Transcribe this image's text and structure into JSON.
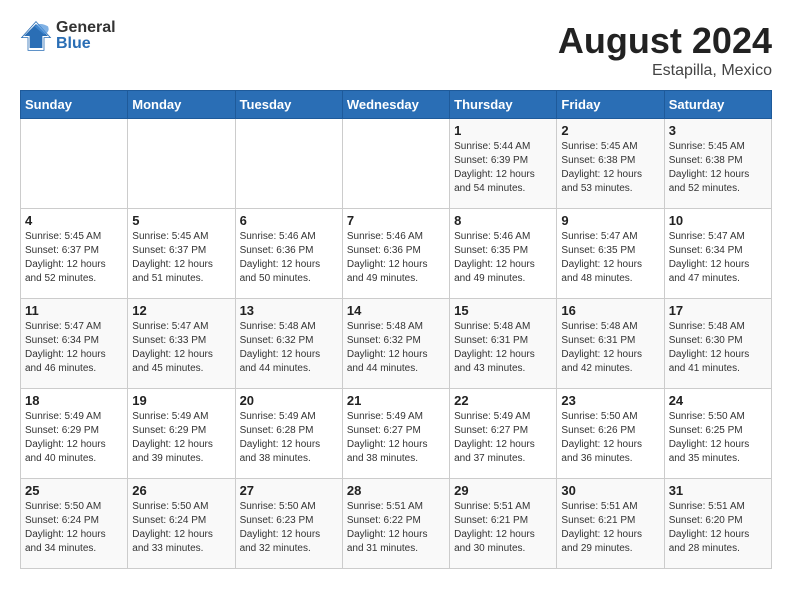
{
  "header": {
    "logo_general": "General",
    "logo_blue": "Blue",
    "month_year": "August 2024",
    "location": "Estapilla, Mexico"
  },
  "days_of_week": [
    "Sunday",
    "Monday",
    "Tuesday",
    "Wednesday",
    "Thursday",
    "Friday",
    "Saturday"
  ],
  "weeks": [
    [
      {
        "day": "",
        "info": ""
      },
      {
        "day": "",
        "info": ""
      },
      {
        "day": "",
        "info": ""
      },
      {
        "day": "",
        "info": ""
      },
      {
        "day": "1",
        "info": "Sunrise: 5:44 AM\nSunset: 6:39 PM\nDaylight: 12 hours\nand 54 minutes."
      },
      {
        "day": "2",
        "info": "Sunrise: 5:45 AM\nSunset: 6:38 PM\nDaylight: 12 hours\nand 53 minutes."
      },
      {
        "day": "3",
        "info": "Sunrise: 5:45 AM\nSunset: 6:38 PM\nDaylight: 12 hours\nand 52 minutes."
      }
    ],
    [
      {
        "day": "4",
        "info": "Sunrise: 5:45 AM\nSunset: 6:37 PM\nDaylight: 12 hours\nand 52 minutes."
      },
      {
        "day": "5",
        "info": "Sunrise: 5:45 AM\nSunset: 6:37 PM\nDaylight: 12 hours\nand 51 minutes."
      },
      {
        "day": "6",
        "info": "Sunrise: 5:46 AM\nSunset: 6:36 PM\nDaylight: 12 hours\nand 50 minutes."
      },
      {
        "day": "7",
        "info": "Sunrise: 5:46 AM\nSunset: 6:36 PM\nDaylight: 12 hours\nand 49 minutes."
      },
      {
        "day": "8",
        "info": "Sunrise: 5:46 AM\nSunset: 6:35 PM\nDaylight: 12 hours\nand 49 minutes."
      },
      {
        "day": "9",
        "info": "Sunrise: 5:47 AM\nSunset: 6:35 PM\nDaylight: 12 hours\nand 48 minutes."
      },
      {
        "day": "10",
        "info": "Sunrise: 5:47 AM\nSunset: 6:34 PM\nDaylight: 12 hours\nand 47 minutes."
      }
    ],
    [
      {
        "day": "11",
        "info": "Sunrise: 5:47 AM\nSunset: 6:34 PM\nDaylight: 12 hours\nand 46 minutes."
      },
      {
        "day": "12",
        "info": "Sunrise: 5:47 AM\nSunset: 6:33 PM\nDaylight: 12 hours\nand 45 minutes."
      },
      {
        "day": "13",
        "info": "Sunrise: 5:48 AM\nSunset: 6:32 PM\nDaylight: 12 hours\nand 44 minutes."
      },
      {
        "day": "14",
        "info": "Sunrise: 5:48 AM\nSunset: 6:32 PM\nDaylight: 12 hours\nand 44 minutes."
      },
      {
        "day": "15",
        "info": "Sunrise: 5:48 AM\nSunset: 6:31 PM\nDaylight: 12 hours\nand 43 minutes."
      },
      {
        "day": "16",
        "info": "Sunrise: 5:48 AM\nSunset: 6:31 PM\nDaylight: 12 hours\nand 42 minutes."
      },
      {
        "day": "17",
        "info": "Sunrise: 5:48 AM\nSunset: 6:30 PM\nDaylight: 12 hours\nand 41 minutes."
      }
    ],
    [
      {
        "day": "18",
        "info": "Sunrise: 5:49 AM\nSunset: 6:29 PM\nDaylight: 12 hours\nand 40 minutes."
      },
      {
        "day": "19",
        "info": "Sunrise: 5:49 AM\nSunset: 6:29 PM\nDaylight: 12 hours\nand 39 minutes."
      },
      {
        "day": "20",
        "info": "Sunrise: 5:49 AM\nSunset: 6:28 PM\nDaylight: 12 hours\nand 38 minutes."
      },
      {
        "day": "21",
        "info": "Sunrise: 5:49 AM\nSunset: 6:27 PM\nDaylight: 12 hours\nand 38 minutes."
      },
      {
        "day": "22",
        "info": "Sunrise: 5:49 AM\nSunset: 6:27 PM\nDaylight: 12 hours\nand 37 minutes."
      },
      {
        "day": "23",
        "info": "Sunrise: 5:50 AM\nSunset: 6:26 PM\nDaylight: 12 hours\nand 36 minutes."
      },
      {
        "day": "24",
        "info": "Sunrise: 5:50 AM\nSunset: 6:25 PM\nDaylight: 12 hours\nand 35 minutes."
      }
    ],
    [
      {
        "day": "25",
        "info": "Sunrise: 5:50 AM\nSunset: 6:24 PM\nDaylight: 12 hours\nand 34 minutes."
      },
      {
        "day": "26",
        "info": "Sunrise: 5:50 AM\nSunset: 6:24 PM\nDaylight: 12 hours\nand 33 minutes."
      },
      {
        "day": "27",
        "info": "Sunrise: 5:50 AM\nSunset: 6:23 PM\nDaylight: 12 hours\nand 32 minutes."
      },
      {
        "day": "28",
        "info": "Sunrise: 5:51 AM\nSunset: 6:22 PM\nDaylight: 12 hours\nand 31 minutes."
      },
      {
        "day": "29",
        "info": "Sunrise: 5:51 AM\nSunset: 6:21 PM\nDaylight: 12 hours\nand 30 minutes."
      },
      {
        "day": "30",
        "info": "Sunrise: 5:51 AM\nSunset: 6:21 PM\nDaylight: 12 hours\nand 29 minutes."
      },
      {
        "day": "31",
        "info": "Sunrise: 5:51 AM\nSunset: 6:20 PM\nDaylight: 12 hours\nand 28 minutes."
      }
    ]
  ]
}
